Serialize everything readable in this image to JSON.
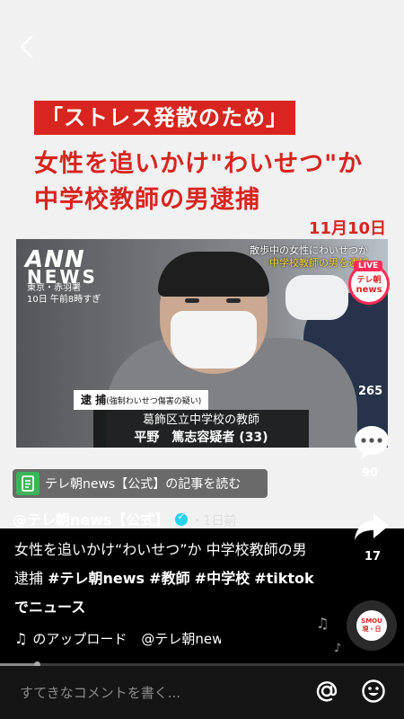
{
  "video": {
    "headline_box": "「ストレス発散のため」",
    "headline_line2": "女性を追いかけ\"わいせつ\"か",
    "headline_line3": "中学校教師の男逮捕",
    "date": "11月10日",
    "logo_main": "ANN",
    "logo_sub": "NEWS",
    "location": "東京・赤羽署",
    "location_time": "10日 午前8時すぎ",
    "corner_line1": "散歩中の女性にわいせつか",
    "corner_line2": "中学校教師の男を逮捕",
    "arrest_label": "逮 捕",
    "arrest_note": "(強制わいせつ傷害の疑い)",
    "name_line1": "葛飾区立中学校の教師",
    "name_line2": "平野　篤志容疑者 (33)"
  },
  "account": {
    "avatar_line1": "テレ朝",
    "avatar_line2": "news",
    "live_badge": "LIVE",
    "username": "@テレ朝news【公式】",
    "time_ago": "・1日前"
  },
  "actions": {
    "like_count": "265",
    "comment_count": "90",
    "share_count": "17"
  },
  "read_banner": {
    "label": "テレ朝news【公式】の記事を読む"
  },
  "caption": {
    "text": "女性を追いかけ“わいせつ”か 中学校教師の男逮捕 ",
    "tags": [
      "#テレ朝news",
      "#教師",
      "#中学校",
      "#tiktokでニュース"
    ]
  },
  "music": {
    "title": "のアップロード",
    "creator": "@テレ朝news",
    "disc_line1": "SMOU",
    "disc_line2": "現・日"
  },
  "progress": {
    "fraction": 0.09
  },
  "comment": {
    "placeholder": "すてきなコメントを書く..."
  },
  "colors": {
    "accent_red": "#d8251f",
    "live_pink": "#ff2d55",
    "verified_cyan": "#20d5ec",
    "banner_green": "#3cb55a"
  },
  "icons": [
    "back-arrow-icon",
    "document-icon",
    "verified-icon",
    "comment-icon",
    "share-icon",
    "music-note-icon",
    "at-icon",
    "emoji-icon"
  ]
}
